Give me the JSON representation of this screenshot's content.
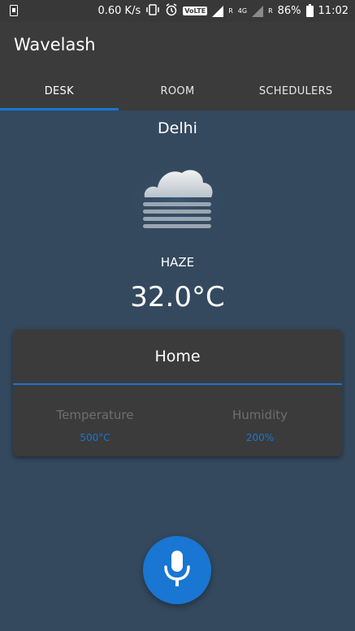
{
  "status_bar": {
    "speed": "0.60 K/s",
    "volte": "VoLTE",
    "network": "4G",
    "roaming_mark": "R",
    "battery": "86%",
    "time": "11:02"
  },
  "app_bar": {
    "title": "Wavelash",
    "tabs": [
      {
        "label": "DESK",
        "active": true
      },
      {
        "label": "ROOM",
        "active": false
      },
      {
        "label": "SCHEDULERS",
        "active": false
      }
    ]
  },
  "weather": {
    "city": "Delhi",
    "icon": "haze-icon",
    "condition": "HAZE",
    "temperature": "32.0°C"
  },
  "card": {
    "title": "Home",
    "temperature_label": "Temperature",
    "temperature_value": "500°C",
    "humidity_label": "Humidity",
    "humidity_value": "200%"
  },
  "mic_button": {
    "icon": "microphone-icon"
  },
  "colors": {
    "background": "#34495e",
    "app_bar": "#3b3b3b",
    "accent": "#1976d2"
  }
}
